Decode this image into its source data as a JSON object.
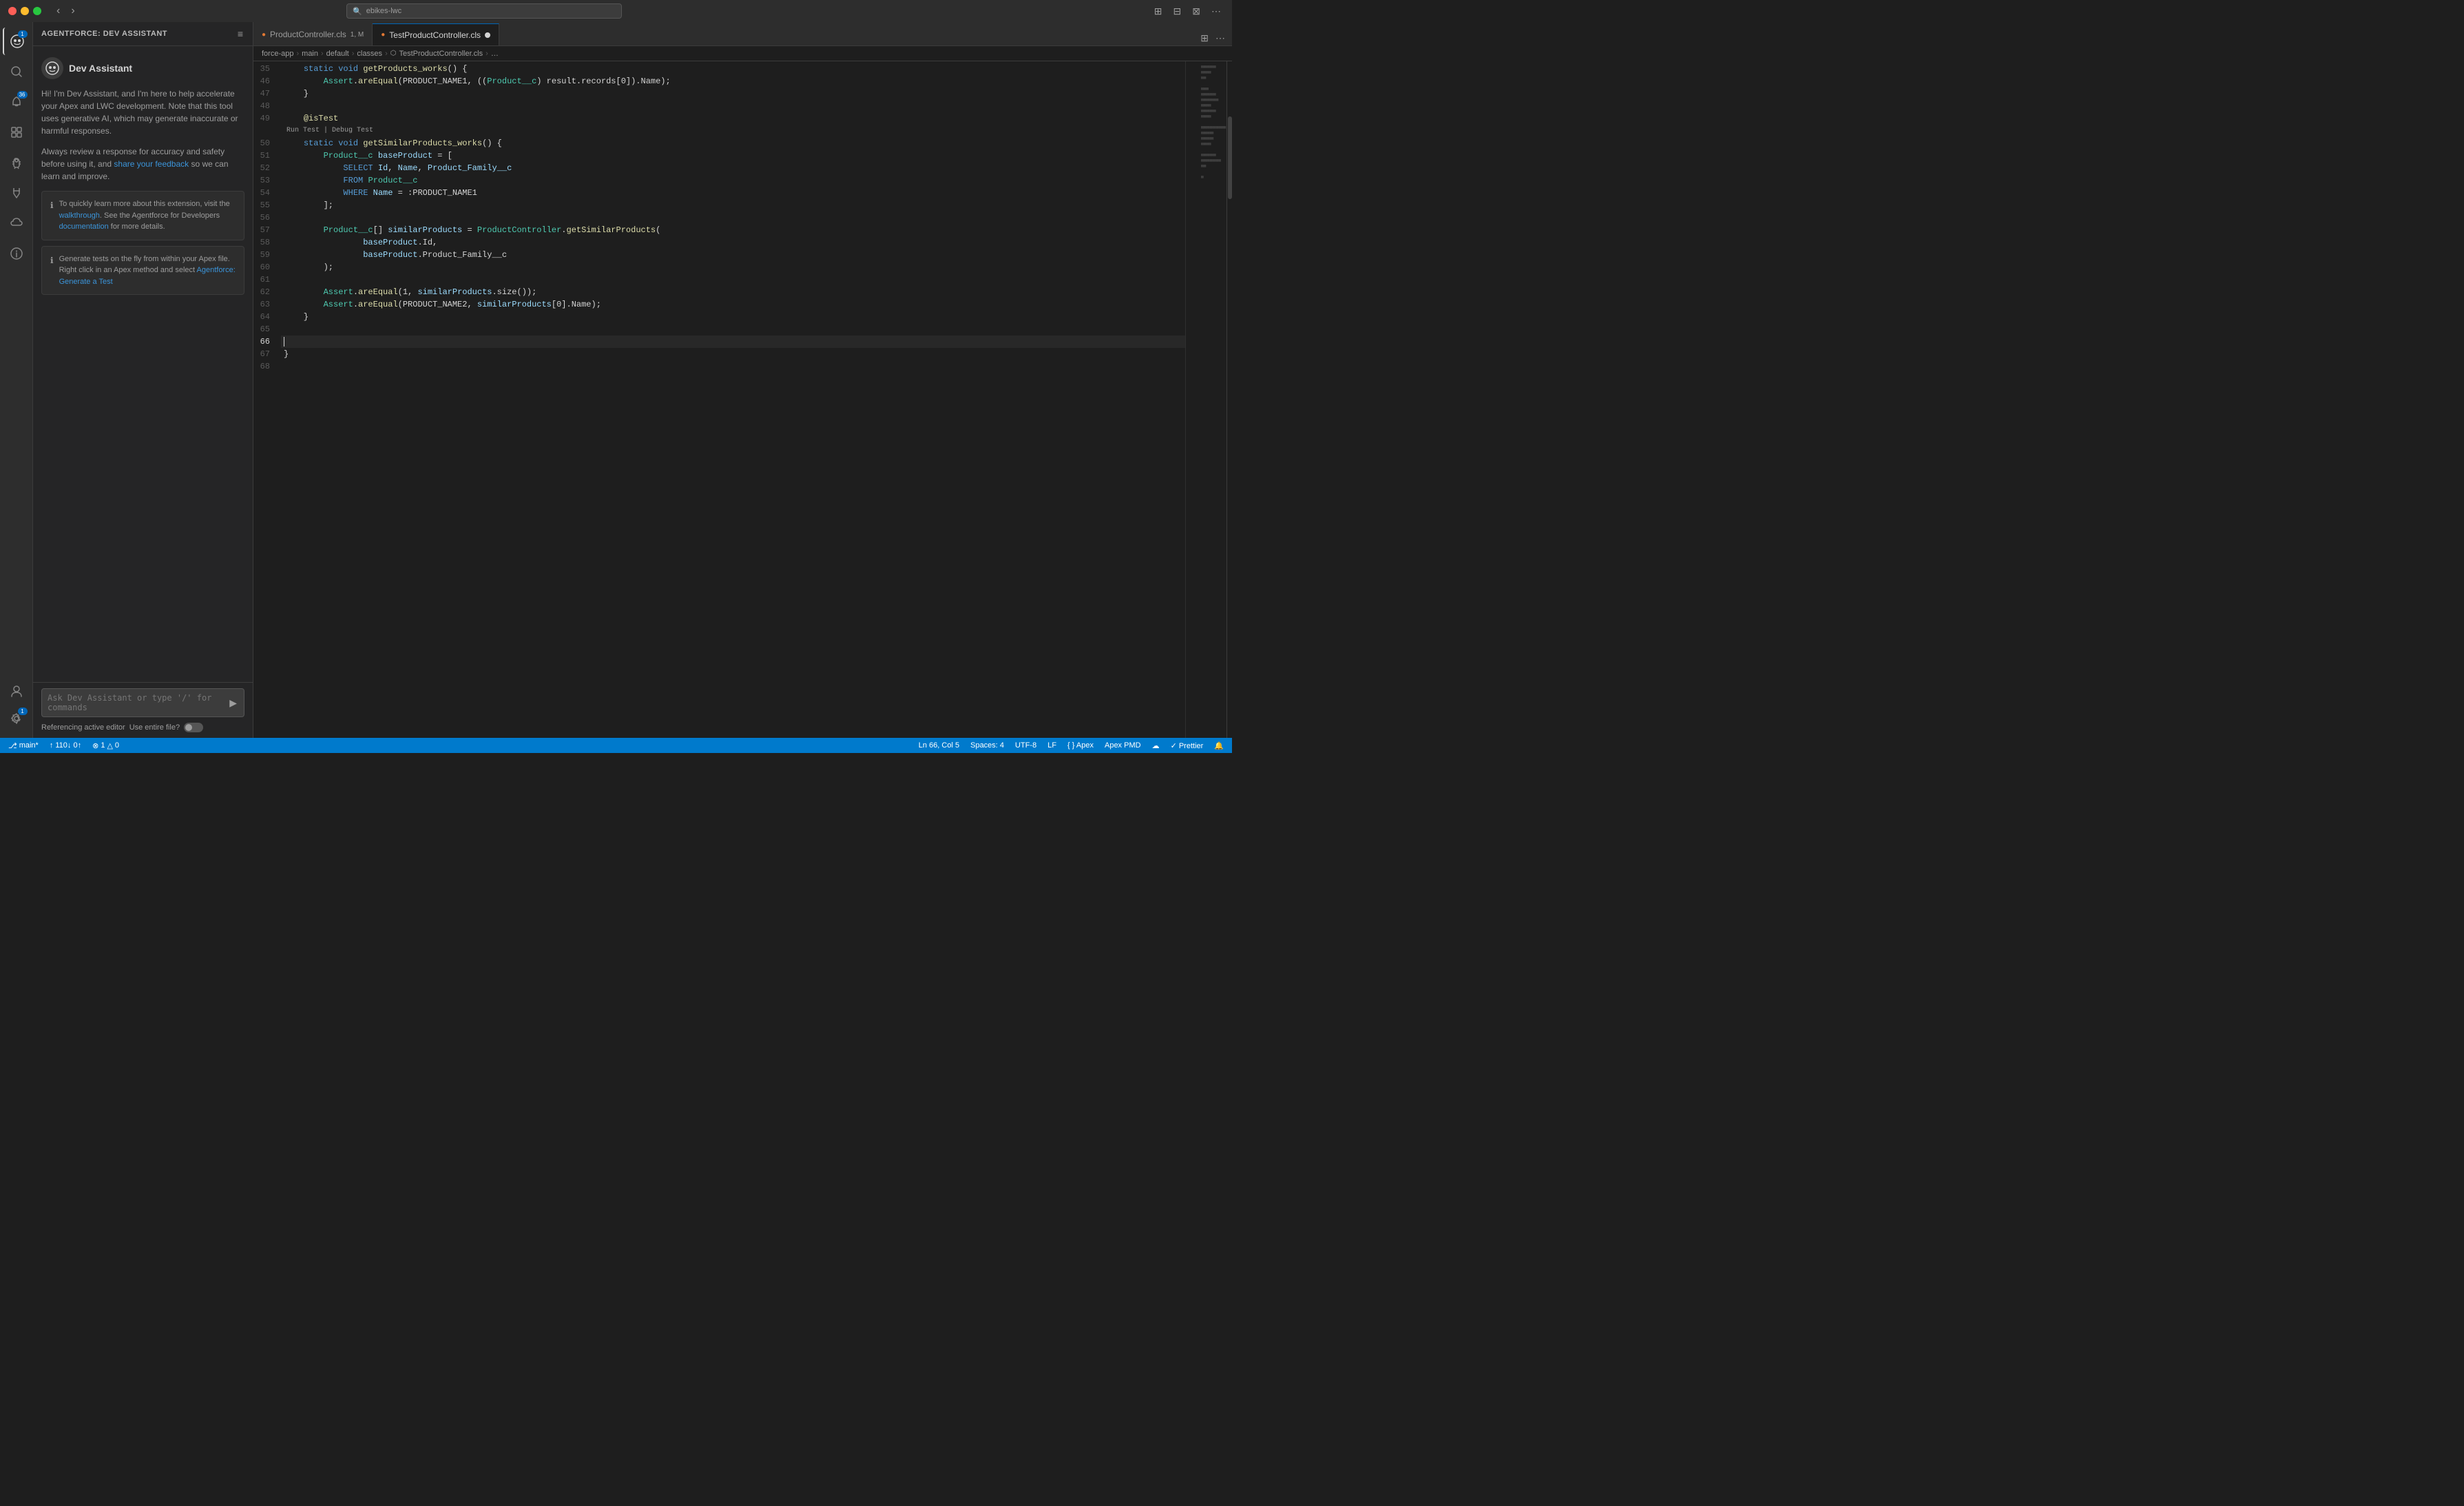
{
  "titleBar": {
    "searchText": "ebikes-lwc",
    "searchPlaceholder": "ebikes-lwc"
  },
  "activityBar": {
    "items": [
      {
        "id": "agentforce",
        "icon": "🤖",
        "badge": "1",
        "badgeColor": "blue",
        "active": true
      },
      {
        "id": "search",
        "icon": "🔍",
        "badge": null
      },
      {
        "id": "notifications",
        "icon": "🔔",
        "badge": "36",
        "badgeColor": "blue"
      },
      {
        "id": "agentforce2",
        "icon": "🧩",
        "badge": null
      },
      {
        "id": "debug",
        "icon": "🐞",
        "badge": null
      },
      {
        "id": "flask",
        "icon": "🧪",
        "badge": null
      },
      {
        "id": "cloud",
        "icon": "☁️",
        "badge": null
      },
      {
        "id": "info",
        "icon": "ℹ️",
        "badge": null
      }
    ],
    "bottomItems": [
      {
        "id": "account",
        "icon": "👤",
        "badge": null
      },
      {
        "id": "settings",
        "icon": "⚙️",
        "badge": "1",
        "badgeColor": "blue"
      }
    ]
  },
  "sidebar": {
    "title": "AGENTFORCE: DEV ASSISTANT",
    "assistant": {
      "name": "Dev Assistant",
      "icon": "🤖",
      "welcomeText": "Hi! I'm Dev Assistant, and I'm here to help accelerate your Apex and LWC development. Note that this tool uses generative AI, which may generate inaccurate or harmful responses.",
      "safetyText": "Always review a response for accuracy and safety before using it, and ",
      "feedbackLinkText": "share your feedback",
      "safetyText2": " so we can learn and improve.",
      "card1": {
        "icon": "ℹ",
        "text1": "To quickly learn more about this extension, visit the ",
        "linkText1": "walkthrough",
        "text2": ". See the Agentforce for Developers ",
        "linkText2": "documentation",
        "text3": " for more details."
      },
      "card2": {
        "icon": "ℹ",
        "text1": "Generate tests on the fly from within your Apex file. Right click in an Apex method and select ",
        "linkText": "Agentforce: Generate a Test"
      }
    },
    "chatInput": {
      "placeholder": "Ask Dev Assistant or type '/' for commands",
      "sendIcon": "▶"
    },
    "footer": {
      "referencingText": "Referencing active editor",
      "useEntireFile": "Use entire file?"
    }
  },
  "tabs": [
    {
      "id": "product-controller",
      "label": "ProductController.cls",
      "badge": "1, M",
      "active": false,
      "modified": false
    },
    {
      "id": "test-product-controller",
      "label": "TestProductController.cls",
      "active": true,
      "modified": true
    }
  ],
  "tabBarRight": {
    "buttons": [
      "⊞",
      "⊟",
      "⊠",
      "≡"
    ]
  },
  "breadcrumb": {
    "items": [
      "force-app",
      "main",
      "default",
      "classes",
      "TestProductController.cls",
      "…"
    ]
  },
  "code": {
    "lines": [
      {
        "num": 35,
        "content": "    static void getProducts_works() {",
        "tokens": [
          {
            "t": "    "
          },
          {
            "t": "static",
            "c": "kw"
          },
          {
            "t": " "
          },
          {
            "t": "void",
            "c": "kw"
          },
          {
            "t": " "
          },
          {
            "t": "getProducts_works",
            "c": "fn"
          },
          {
            "t": "() {"
          }
        ]
      },
      {
        "num": 46,
        "content": "        Assert.areEqual(PRODUCT_NAME1, ((Product__c) result.records[0]).Name);",
        "tokens": [
          {
            "t": "        "
          },
          {
            "t": "Assert",
            "c": "type"
          },
          {
            "t": "."
          },
          {
            "t": "areEqual",
            "c": "fn"
          },
          {
            "t": "(PRODUCT_NAME1, (("
          },
          {
            "t": "Product__c",
            "c": "type"
          },
          {
            "t": ") result.records[0]).Name);"
          }
        ]
      },
      {
        "num": 47,
        "content": "    }",
        "tokens": [
          {
            "t": "    }"
          }
        ]
      },
      {
        "num": 48,
        "content": "",
        "tokens": []
      },
      {
        "num": 49,
        "content": "    @isTest",
        "tokens": [
          {
            "t": "    "
          },
          {
            "t": "@isTest",
            "c": "ann"
          }
        ]
      },
      {
        "num": 49,
        "inlineAction": "Run Test | Debug Test",
        "content": "",
        "tokens": []
      },
      {
        "num": 50,
        "content": "    static void getSimilarProducts_works() {",
        "tokens": [
          {
            "t": "    "
          },
          {
            "t": "static",
            "c": "kw"
          },
          {
            "t": " "
          },
          {
            "t": "void",
            "c": "kw"
          },
          {
            "t": " "
          },
          {
            "t": "getSimilarProducts_works",
            "c": "fn"
          },
          {
            "t": "() {"
          }
        ]
      },
      {
        "num": 51,
        "content": "        Product__c baseProduct = [",
        "tokens": [
          {
            "t": "        "
          },
          {
            "t": "Product__c",
            "c": "type"
          },
          {
            "t": " "
          },
          {
            "t": "baseProduct",
            "c": "var"
          },
          {
            "t": " = ["
          }
        ]
      },
      {
        "num": 52,
        "content": "            SELECT Id, Name, Product_Family__c",
        "tokens": [
          {
            "t": "            "
          },
          {
            "t": "SELECT",
            "c": "soql-kw"
          },
          {
            "t": " "
          },
          {
            "t": "Id",
            "c": "soql-field"
          },
          {
            "t": ", "
          },
          {
            "t": "Name",
            "c": "soql-field"
          },
          {
            "t": ", "
          },
          {
            "t": "Product_Family__c",
            "c": "soql-field"
          }
        ]
      },
      {
        "num": 53,
        "content": "            FROM Product__c",
        "tokens": [
          {
            "t": "            "
          },
          {
            "t": "FROM",
            "c": "soql-kw"
          },
          {
            "t": " "
          },
          {
            "t": "Product__c",
            "c": "type"
          }
        ]
      },
      {
        "num": 54,
        "content": "            WHERE Name = :PRODUCT_NAME1",
        "tokens": [
          {
            "t": "            "
          },
          {
            "t": "WHERE",
            "c": "soql-kw"
          },
          {
            "t": " "
          },
          {
            "t": "Name",
            "c": "soql-field"
          },
          {
            "t": " = :PRODUCT_NAME1"
          }
        ]
      },
      {
        "num": 55,
        "content": "        ];",
        "tokens": [
          {
            "t": "        ];"
          }
        ]
      },
      {
        "num": 56,
        "content": "",
        "tokens": []
      },
      {
        "num": 57,
        "content": "        Product__c[] similarProducts = ProductController.getSimilarProducts(",
        "tokens": [
          {
            "t": "        "
          },
          {
            "t": "Product__c",
            "c": "type"
          },
          {
            "t": "[] "
          },
          {
            "t": "similarProducts",
            "c": "var"
          },
          {
            "t": " = "
          },
          {
            "t": "ProductController",
            "c": "type"
          },
          {
            "t": "."
          },
          {
            "t": "getSimilarProducts",
            "c": "fn"
          },
          {
            "t": "("
          }
        ]
      },
      {
        "num": 58,
        "content": "                baseProduct.Id,",
        "tokens": [
          {
            "t": "                "
          },
          {
            "t": "baseProduct",
            "c": "var"
          },
          {
            "t": ".Id,"
          }
        ]
      },
      {
        "num": 59,
        "content": "                baseProduct.Product_Family__c",
        "tokens": [
          {
            "t": "                "
          },
          {
            "t": "baseProduct",
            "c": "var"
          },
          {
            "t": ".Product_Family__c"
          }
        ]
      },
      {
        "num": 60,
        "content": "        );",
        "tokens": [
          {
            "t": "        );"
          }
        ]
      },
      {
        "num": 61,
        "content": "",
        "tokens": []
      },
      {
        "num": 62,
        "content": "        Assert.areEqual(1, similarProducts.size());",
        "tokens": [
          {
            "t": "        "
          },
          {
            "t": "Assert",
            "c": "type"
          },
          {
            "t": "."
          },
          {
            "t": "areEqual",
            "c": "fn"
          },
          {
            "t": "(1, "
          },
          {
            "t": "similarProducts",
            "c": "var"
          },
          {
            "t": ".size());"
          }
        ]
      },
      {
        "num": 63,
        "content": "        Assert.areEqual(PRODUCT_NAME2, similarProducts[0].Name);",
        "tokens": [
          {
            "t": "        "
          },
          {
            "t": "Assert",
            "c": "type"
          },
          {
            "t": "."
          },
          {
            "t": "areEqual",
            "c": "fn"
          },
          {
            "t": "(PRODUCT_NAME2, "
          },
          {
            "t": "similarProducts",
            "c": "var"
          },
          {
            "t": "[0].Name);"
          }
        ]
      },
      {
        "num": 64,
        "content": "    }",
        "tokens": [
          {
            "t": "    }"
          }
        ]
      },
      {
        "num": 65,
        "content": "",
        "tokens": [],
        "activeLine": true
      },
      {
        "num": 66,
        "content": "",
        "tokens": [],
        "cursorLine": true
      },
      {
        "num": 67,
        "content": "}",
        "tokens": [
          {
            "t": "}"
          }
        ]
      },
      {
        "num": 68,
        "content": "",
        "tokens": []
      }
    ]
  },
  "statusBar": {
    "branch": "main*",
    "sync": "↑ 110↓ 0↑",
    "errors": "⊗ 1",
    "warnings": "△ 0",
    "position": "Ln 66, Col 5",
    "spaces": "Spaces: 4",
    "encoding": "UTF-8",
    "lineEnding": "LF",
    "language": "{ } Apex",
    "formatter": "Apex PMD",
    "beautify": "✓ Prettier",
    "notifications": "🔔"
  }
}
